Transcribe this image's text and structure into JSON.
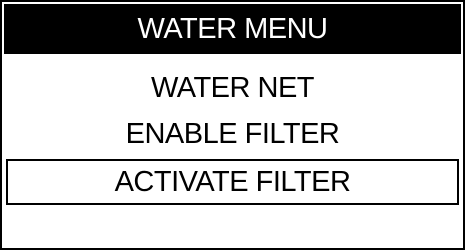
{
  "menu": {
    "title": "WATER MENU",
    "items": [
      {
        "label": "WATER NET",
        "selected": false
      },
      {
        "label": "ENABLE FILTER",
        "selected": false
      },
      {
        "label": "ACTIVATE FILTER",
        "selected": true
      }
    ]
  },
  "colors": {
    "background": "#ffffff",
    "foreground": "#000000",
    "title_bar": "#000000",
    "title_text": "#ffffff"
  }
}
